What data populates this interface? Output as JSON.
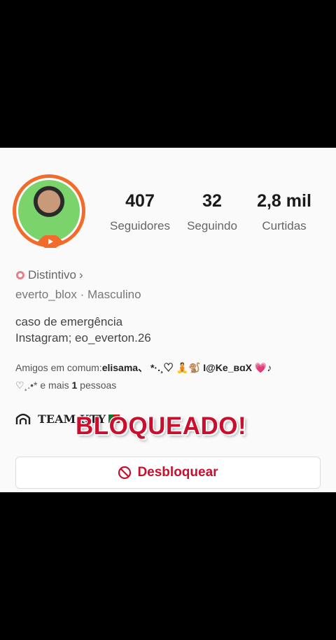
{
  "profile": {
    "stats": [
      {
        "value": "407",
        "label": "Seguidores"
      },
      {
        "value": "32",
        "label": "Seguindo"
      },
      {
        "value": "2,8 mil",
        "label": "Curtidas"
      }
    ],
    "badge_label": "Distintivo",
    "badge_chevron": "›",
    "username_line": "everto_blox · Masculino",
    "bio_line1": "caso de emergência",
    "bio_line2": "Instagram; eo_everton.26",
    "mutual_prefix": "Amigos em comum:",
    "mutual_names": "elisama、 *·.¸♡ 🧘🐒 I@Ke_вɑX 💗♪",
    "mutual_line2_prefix": "♡¸.•* e mais ",
    "mutual_count": "1",
    "mutual_suffix": " pessoas",
    "team_label": "TEAM KTY",
    "overlay_text": "BLOQUEADO!",
    "unblock_label": "Desbloquear"
  },
  "colors": {
    "accent_red": "#c8102e",
    "ring_orange": "#f26b2a",
    "background": "#fafafa"
  },
  "icons": {
    "badge": "badge-icon",
    "team": "team-icon",
    "unblock": "block-icon"
  }
}
